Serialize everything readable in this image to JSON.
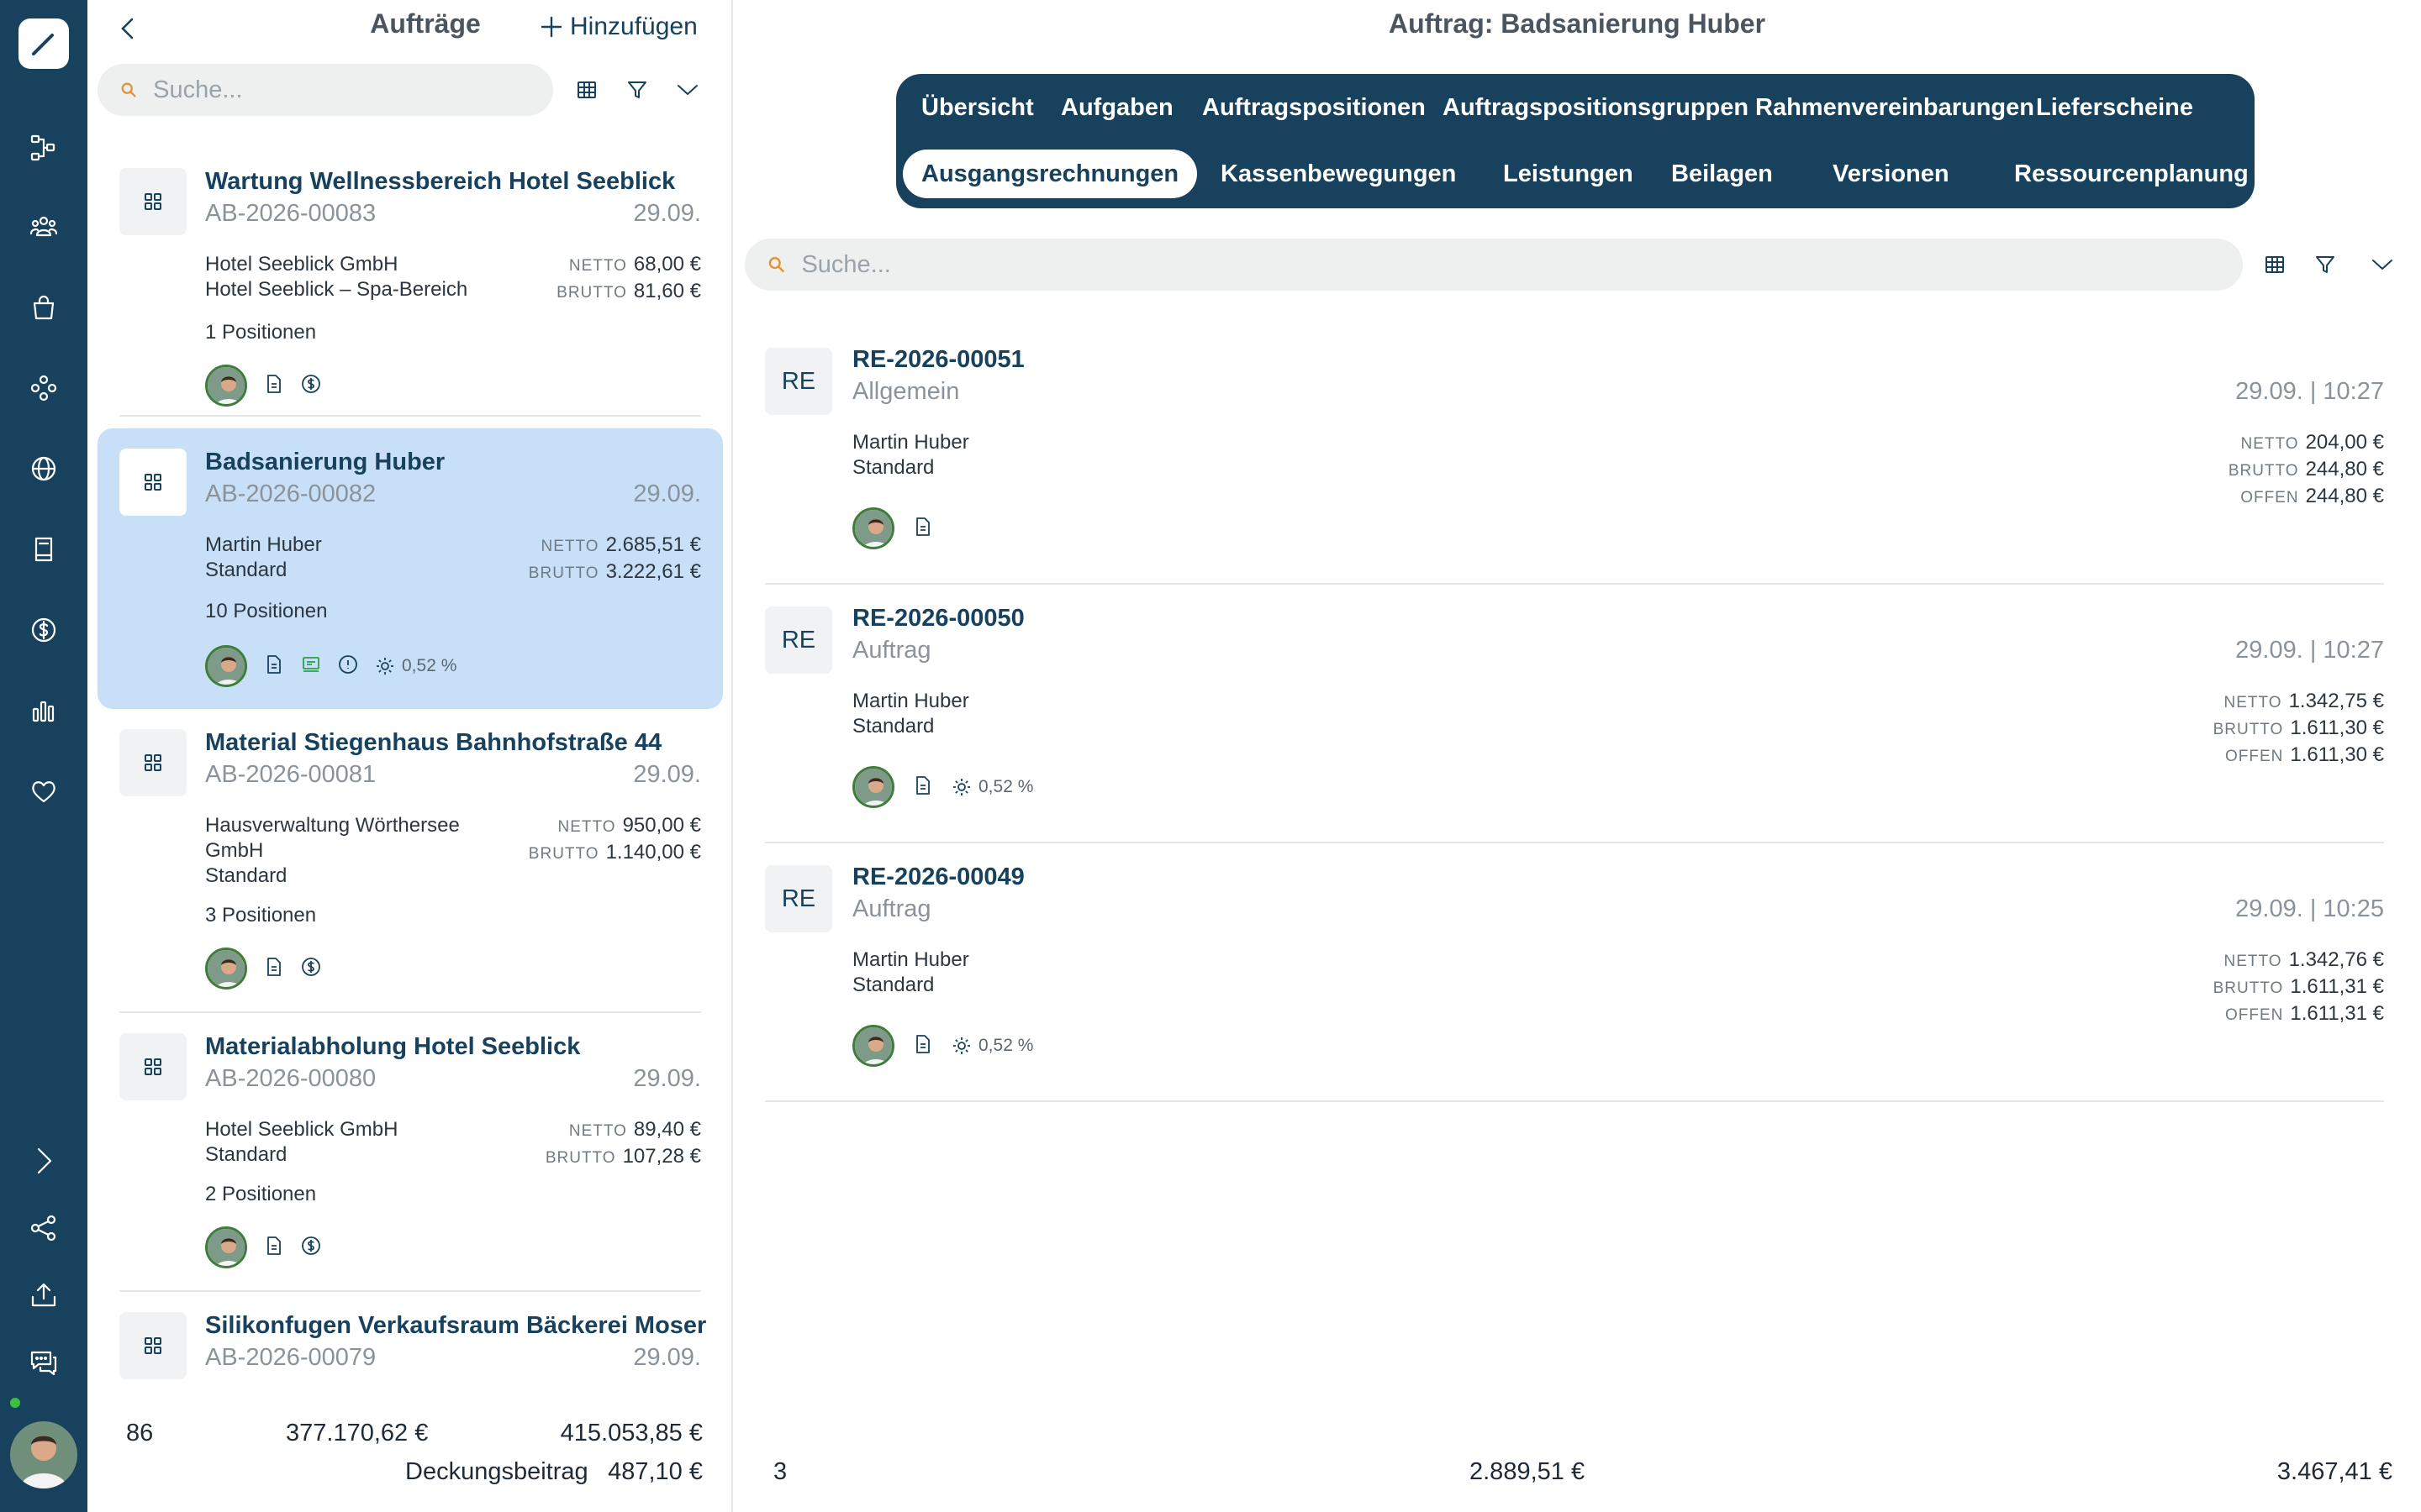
{
  "app": {
    "accent": "#17415c",
    "selected_bg": "#c7e0f7"
  },
  "rail": {
    "icons": [
      "pen-icon",
      "workflow-icon",
      "users-icon",
      "shopping-bag-icon",
      "modules-icon",
      "globe-icon",
      "book-icon",
      "dollar-icon",
      "bar-chart-icon",
      "heart-icon",
      "expand-chevron-icon",
      "share-icon",
      "upload-icon",
      "chat-icon"
    ]
  },
  "list_panel": {
    "title": "Aufträge",
    "add_label": "Hinzufügen",
    "search_placeholder": "Suche...",
    "cards": [
      {
        "title": "Wartung Wellnessbereich Hotel Seeblick",
        "number": "AB-2026-00083",
        "date": "29.09.",
        "client_lines": [
          "Hotel Seeblick GmbH",
          "Hotel Seeblick – Spa-Bereich"
        ],
        "netto_label": "NETTO",
        "netto": "68,00 €",
        "brutto_label": "BRUTTO",
        "brutto": "81,60 €",
        "positions": "1 Positionen"
      },
      {
        "title": "Badsanierung Huber",
        "number": "AB-2026-00082",
        "date": "29.09.",
        "client_lines": [
          "Martin Huber",
          "Standard"
        ],
        "netto_label": "NETTO",
        "netto": "2.685,51 €",
        "brutto_label": "BRUTTO",
        "brutto": "3.222,61 €",
        "positions": "10 Positionen",
        "margin": "0,52 %",
        "selected": true
      },
      {
        "title": "Material Stiegenhaus Bahnhofstraße 44",
        "number": "AB-2026-00081",
        "date": "29.09.",
        "client_lines": [
          "Hausverwaltung Wörthersee GmbH",
          "Standard"
        ],
        "netto_label": "NETTO",
        "netto": "950,00 €",
        "brutto_label": "BRUTTO",
        "brutto": "1.140,00 €",
        "positions": "3 Positionen"
      },
      {
        "title": "Materialabholung Hotel Seeblick",
        "number": "AB-2026-00080",
        "date": "29.09.",
        "client_lines": [
          "Hotel Seeblick GmbH",
          "Standard"
        ],
        "netto_label": "NETTO",
        "netto": "89,40 €",
        "brutto_label": "BRUTTO",
        "brutto": "107,28 €",
        "positions": "2 Positionen"
      },
      {
        "title": "Silikonfugen Verkaufsraum Bäckerei Moser",
        "number": "AB-2026-00079",
        "date": "29.09."
      }
    ],
    "footer": {
      "count": "86",
      "netto_total": "377.170,62 €",
      "brutto_total": "415.053,85 €",
      "margin_label": "Deckungsbeitrag",
      "margin_value": "487,10 €"
    }
  },
  "detail": {
    "title": "Auftrag: Badsanierung Huber",
    "tabs": [
      "Übersicht",
      "Aufgaben",
      "Auftragspositionen",
      "Auftragspositionsgruppen",
      "Rahmenvereinbarungen",
      "Lieferscheine",
      "Ausgangsrechnungen",
      "Kassenbewegungen",
      "Leistungen",
      "Beilagen",
      "Versionen",
      "Ressourcenplanung"
    ],
    "active_tab": "Ausgangsrechnungen",
    "search_placeholder": "Suche...",
    "invoices": [
      {
        "badge": "RE",
        "number": "RE-2026-00051",
        "type": "Allgemein",
        "datetime": "29.09. | 10:27",
        "client": "Martin Huber",
        "category": "Standard",
        "netto_label": "NETTO",
        "netto": "204,00 €",
        "brutto_label": "BRUTTO",
        "brutto": "244,80 €",
        "offen_label": "OFFEN",
        "offen": "244,80 €"
      },
      {
        "badge": "RE",
        "number": "RE-2026-00050",
        "type": "Auftrag",
        "datetime": "29.09. | 10:27",
        "client": "Martin Huber",
        "category": "Standard",
        "netto_label": "NETTO",
        "netto": "1.342,75 €",
        "brutto_label": "BRUTTO",
        "brutto": "1.611,30 €",
        "offen_label": "OFFEN",
        "offen": "1.611,30 €",
        "margin": "0,52 %"
      },
      {
        "badge": "RE",
        "number": "RE-2026-00049",
        "type": "Auftrag",
        "datetime": "29.09. | 10:25",
        "client": "Martin Huber",
        "category": "Standard",
        "netto_label": "NETTO",
        "netto": "1.342,76 €",
        "brutto_label": "BRUTTO",
        "brutto": "1.611,31 €",
        "offen_label": "OFFEN",
        "offen": "1.611,31 €",
        "margin": "0,52 %"
      }
    ],
    "footer": {
      "count": "3",
      "netto_total": "2.889,51 €",
      "brutto_total": "3.467,41 €"
    }
  }
}
